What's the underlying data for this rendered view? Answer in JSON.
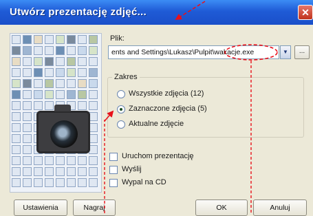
{
  "window": {
    "title": "Utwórz prezentację zdjęć...",
    "close_glyph": "✕"
  },
  "file": {
    "label": "Plik:",
    "value": "ents and Settings\\Lukasz\\Pulpit\\wakacje.exe",
    "dropdown_glyph": "▼",
    "browse_label": "..."
  },
  "scope": {
    "legend": "Zakres",
    "options": [
      {
        "label": "Wszystkie zdjęcia (12)",
        "checked": false
      },
      {
        "label": "Zaznaczone zdjęcia (5)",
        "checked": true
      },
      {
        "label": "Aktualne zdjęcie",
        "checked": false
      }
    ]
  },
  "checks": [
    {
      "label": "Uruchom prezentację",
      "checked": false
    },
    {
      "label": "Wyślij",
      "checked": false
    },
    {
      "label": "Wypal na CD",
      "checked": false
    }
  ],
  "buttons": {
    "left1": "Ustawienia",
    "left2": "Nagraj",
    "ok": "OK",
    "cancel": "Anuluj"
  },
  "colors": {
    "titlebar": "#1f5bd6",
    "annotation": "#e8101a",
    "dialog_bg": "#ece9d8"
  },
  "icons": {
    "close": "close-icon",
    "dropdown": "chevron-down-icon",
    "camera": "camera-icon"
  }
}
